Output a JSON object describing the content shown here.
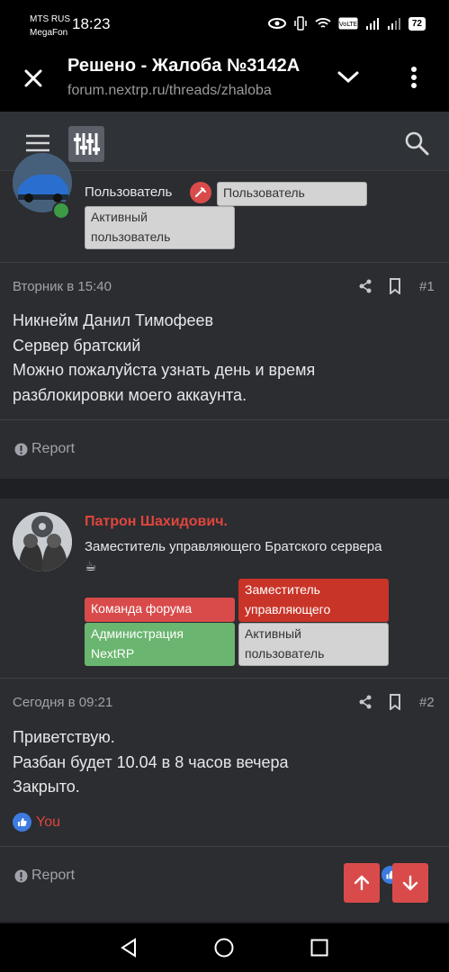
{
  "status_bar": {
    "carrier_1": "MTS RUS",
    "carrier_2": "MegaFon",
    "time": "18:23",
    "battery": "72"
  },
  "browser": {
    "title": "Решено - Жалоба №3142А",
    "url": "forum.nextrp.ru/threads/zhaloba"
  },
  "post1": {
    "user_role": "Пользователь",
    "badges": [
      "Пользователь",
      "Активный пользователь"
    ],
    "date": "Вторник в 15:40",
    "number": "#1",
    "message": [
      "Никнейм Данил Тимофеев",
      "Сервер братский",
      "Можно пожалуйста узнать день и время",
      "разблокировки моего аккаунта."
    ],
    "report": "Report"
  },
  "post2": {
    "author": "Патрон Шахидович.",
    "title_line1": "Заместитель управляющего Братского сервера",
    "title_line2": "☕",
    "badges": {
      "team": "Команда форума",
      "deputy": "Заместитель управляющего",
      "admin": "Администрация NextRP",
      "active": "Активный пользователь"
    },
    "date": "Сегодня в 09:21",
    "number": "#2",
    "message": [
      "Приветствую.",
      "Разбан будет 10.04 в 8 часов вечера",
      "Закрыто."
    ],
    "reaction": "You",
    "report": "Report"
  },
  "colors": {
    "accent_red": "#d94b4b",
    "author_red": "#e0453d",
    "bg": "#2b2d31"
  }
}
